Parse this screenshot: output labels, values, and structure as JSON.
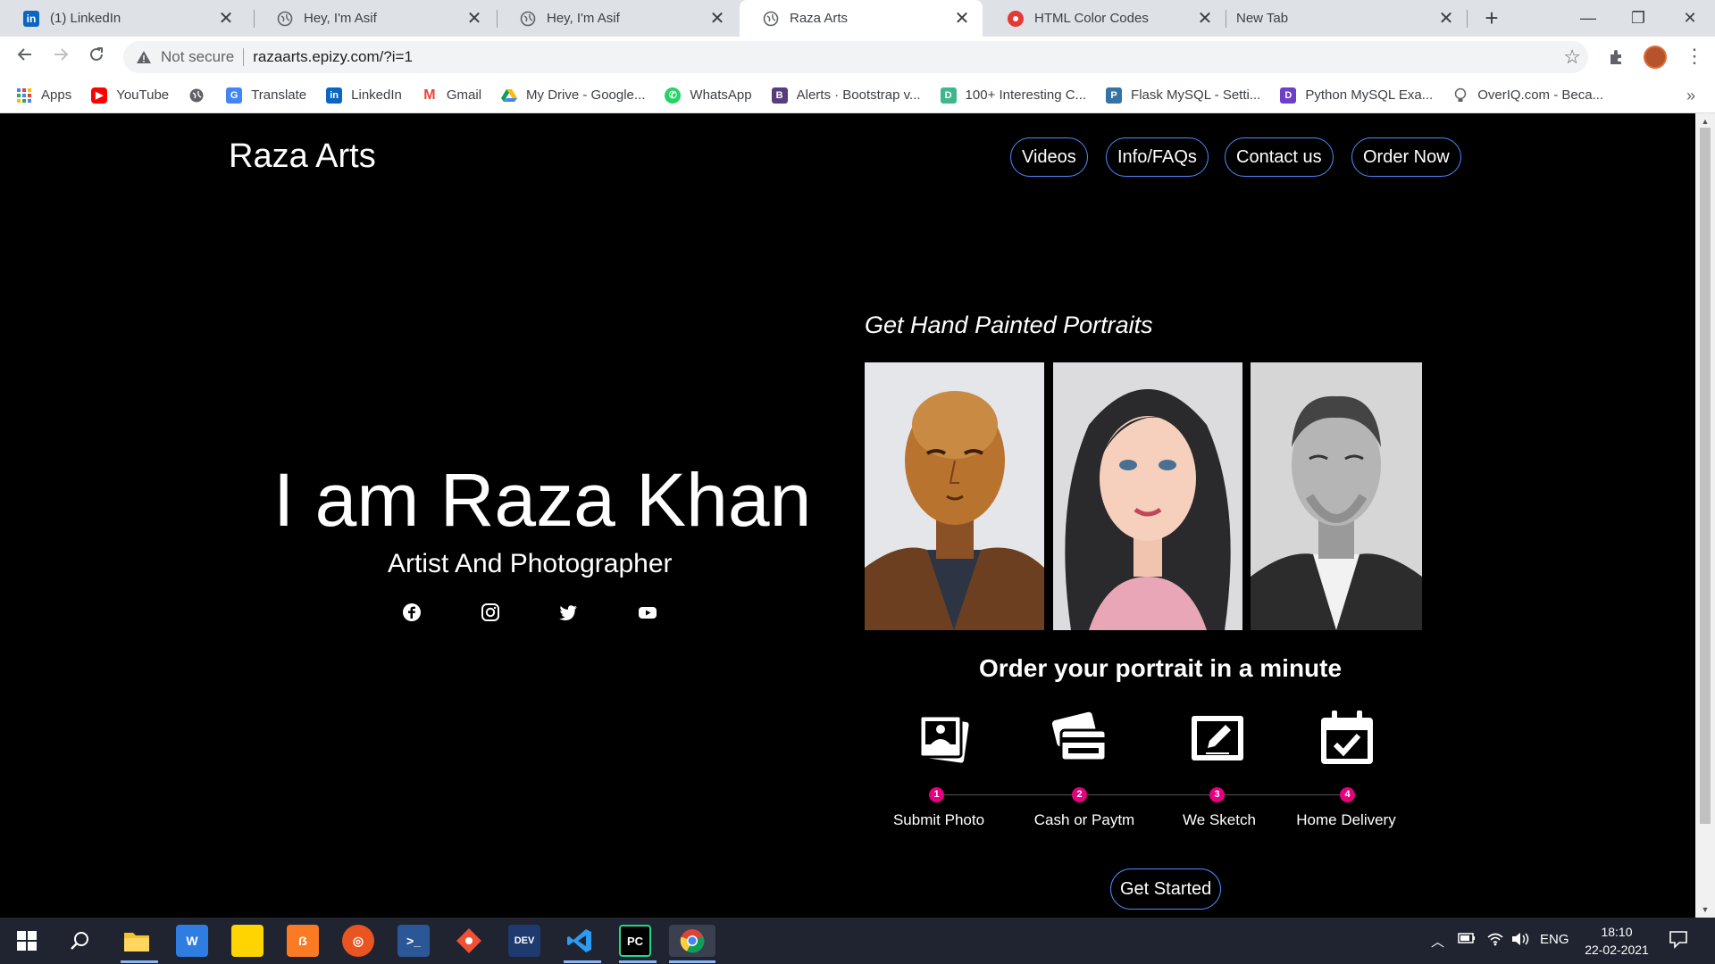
{
  "browser": {
    "tabs": [
      {
        "title": "(1) LinkedIn",
        "icon": "linkedin-icon",
        "color": "#0a66c2"
      },
      {
        "title": "Hey, I'm Asif",
        "icon": "globe-icon",
        "color": "#5f6368"
      },
      {
        "title": "Hey, I'm Asif",
        "icon": "globe-icon",
        "color": "#5f6368"
      },
      {
        "title": "Raza Arts",
        "icon": "globe-icon",
        "color": "#5f6368",
        "active": true
      },
      {
        "title": "HTML Color Codes",
        "icon": "htmlcolor-icon",
        "color": "#e53935"
      },
      {
        "title": "New Tab",
        "icon": "",
        "color": ""
      }
    ],
    "close_glyph": "✕",
    "new_tab_glyph": "+",
    "window_controls": {
      "minimize": "—",
      "restore": "❐",
      "close": "✕"
    },
    "omnibox": {
      "security_label": "Not secure",
      "url": "razaarts.epizy.com/?i=1"
    },
    "bookmarks": [
      {
        "label": "Apps",
        "icon": "apps-icon",
        "color": "#4285f4"
      },
      {
        "label": "YouTube",
        "icon": "youtube-icon",
        "color": "#ff0000"
      },
      {
        "label": "",
        "icon": "globe-icon",
        "color": "#5f6368"
      },
      {
        "label": "Translate",
        "icon": "translate-icon",
        "color": "#4285f4"
      },
      {
        "label": "LinkedIn",
        "icon": "linkedin-icon",
        "color": "#0a66c2"
      },
      {
        "label": "Gmail",
        "icon": "gmail-icon",
        "color": "#ea4335"
      },
      {
        "label": "My Drive - Google...",
        "icon": "drive-icon",
        "color": "#fbbc04"
      },
      {
        "label": "WhatsApp",
        "icon": "whatsapp-icon",
        "color": "#25d366"
      },
      {
        "label": "Alerts · Bootstrap v...",
        "icon": "bootstrap-icon",
        "color": "#563d7c"
      },
      {
        "label": "100+ Interesting C...",
        "icon": "dev-icon",
        "color": "#3fb68b"
      },
      {
        "label": "Flask MySQL - Setti...",
        "icon": "python-icon",
        "color": "#3572a5"
      },
      {
        "label": "Python MySQL Exa...",
        "icon": "d-icon",
        "color": "#6e40c9"
      },
      {
        "label": "OverIQ.com - Beca...",
        "icon": "bulb-icon",
        "color": "#5f6368"
      }
    ]
  },
  "site": {
    "brand": "Raza Arts",
    "nav": [
      "Videos",
      "Info/FAQs",
      "Contact us",
      "Order Now"
    ],
    "hero_title": "I am Raza Khan",
    "hero_subtitle": "Artist And Photographer",
    "social": [
      "facebook-icon",
      "instagram-icon",
      "twitter-icon",
      "youtube-icon"
    ],
    "tagline": "Get Hand Painted Portraits",
    "order_title": "Order your portrait in a minute",
    "steps": [
      {
        "num": "1",
        "label": "Submit Photo",
        "icon": "photos-icon"
      },
      {
        "num": "2",
        "label": "Cash or Paytm",
        "icon": "cards-icon"
      },
      {
        "num": "3",
        "label": "We Sketch",
        "icon": "sketch-icon"
      },
      {
        "num": "4",
        "label": "Home Delivery",
        "icon": "calendar-check-icon"
      }
    ],
    "cta": "Get Started",
    "accent": "#e6007e",
    "outline": "#4d8cff"
  },
  "taskbar": {
    "language": "ENG",
    "time": "18:10",
    "date": "22-02-2021",
    "apps": [
      "start",
      "search",
      "file-explorer",
      "wps",
      "sticky-notes",
      "xampp",
      "ubuntu",
      "powershell",
      "git",
      "devc",
      "vscode",
      "pycharm",
      "chrome"
    ]
  }
}
